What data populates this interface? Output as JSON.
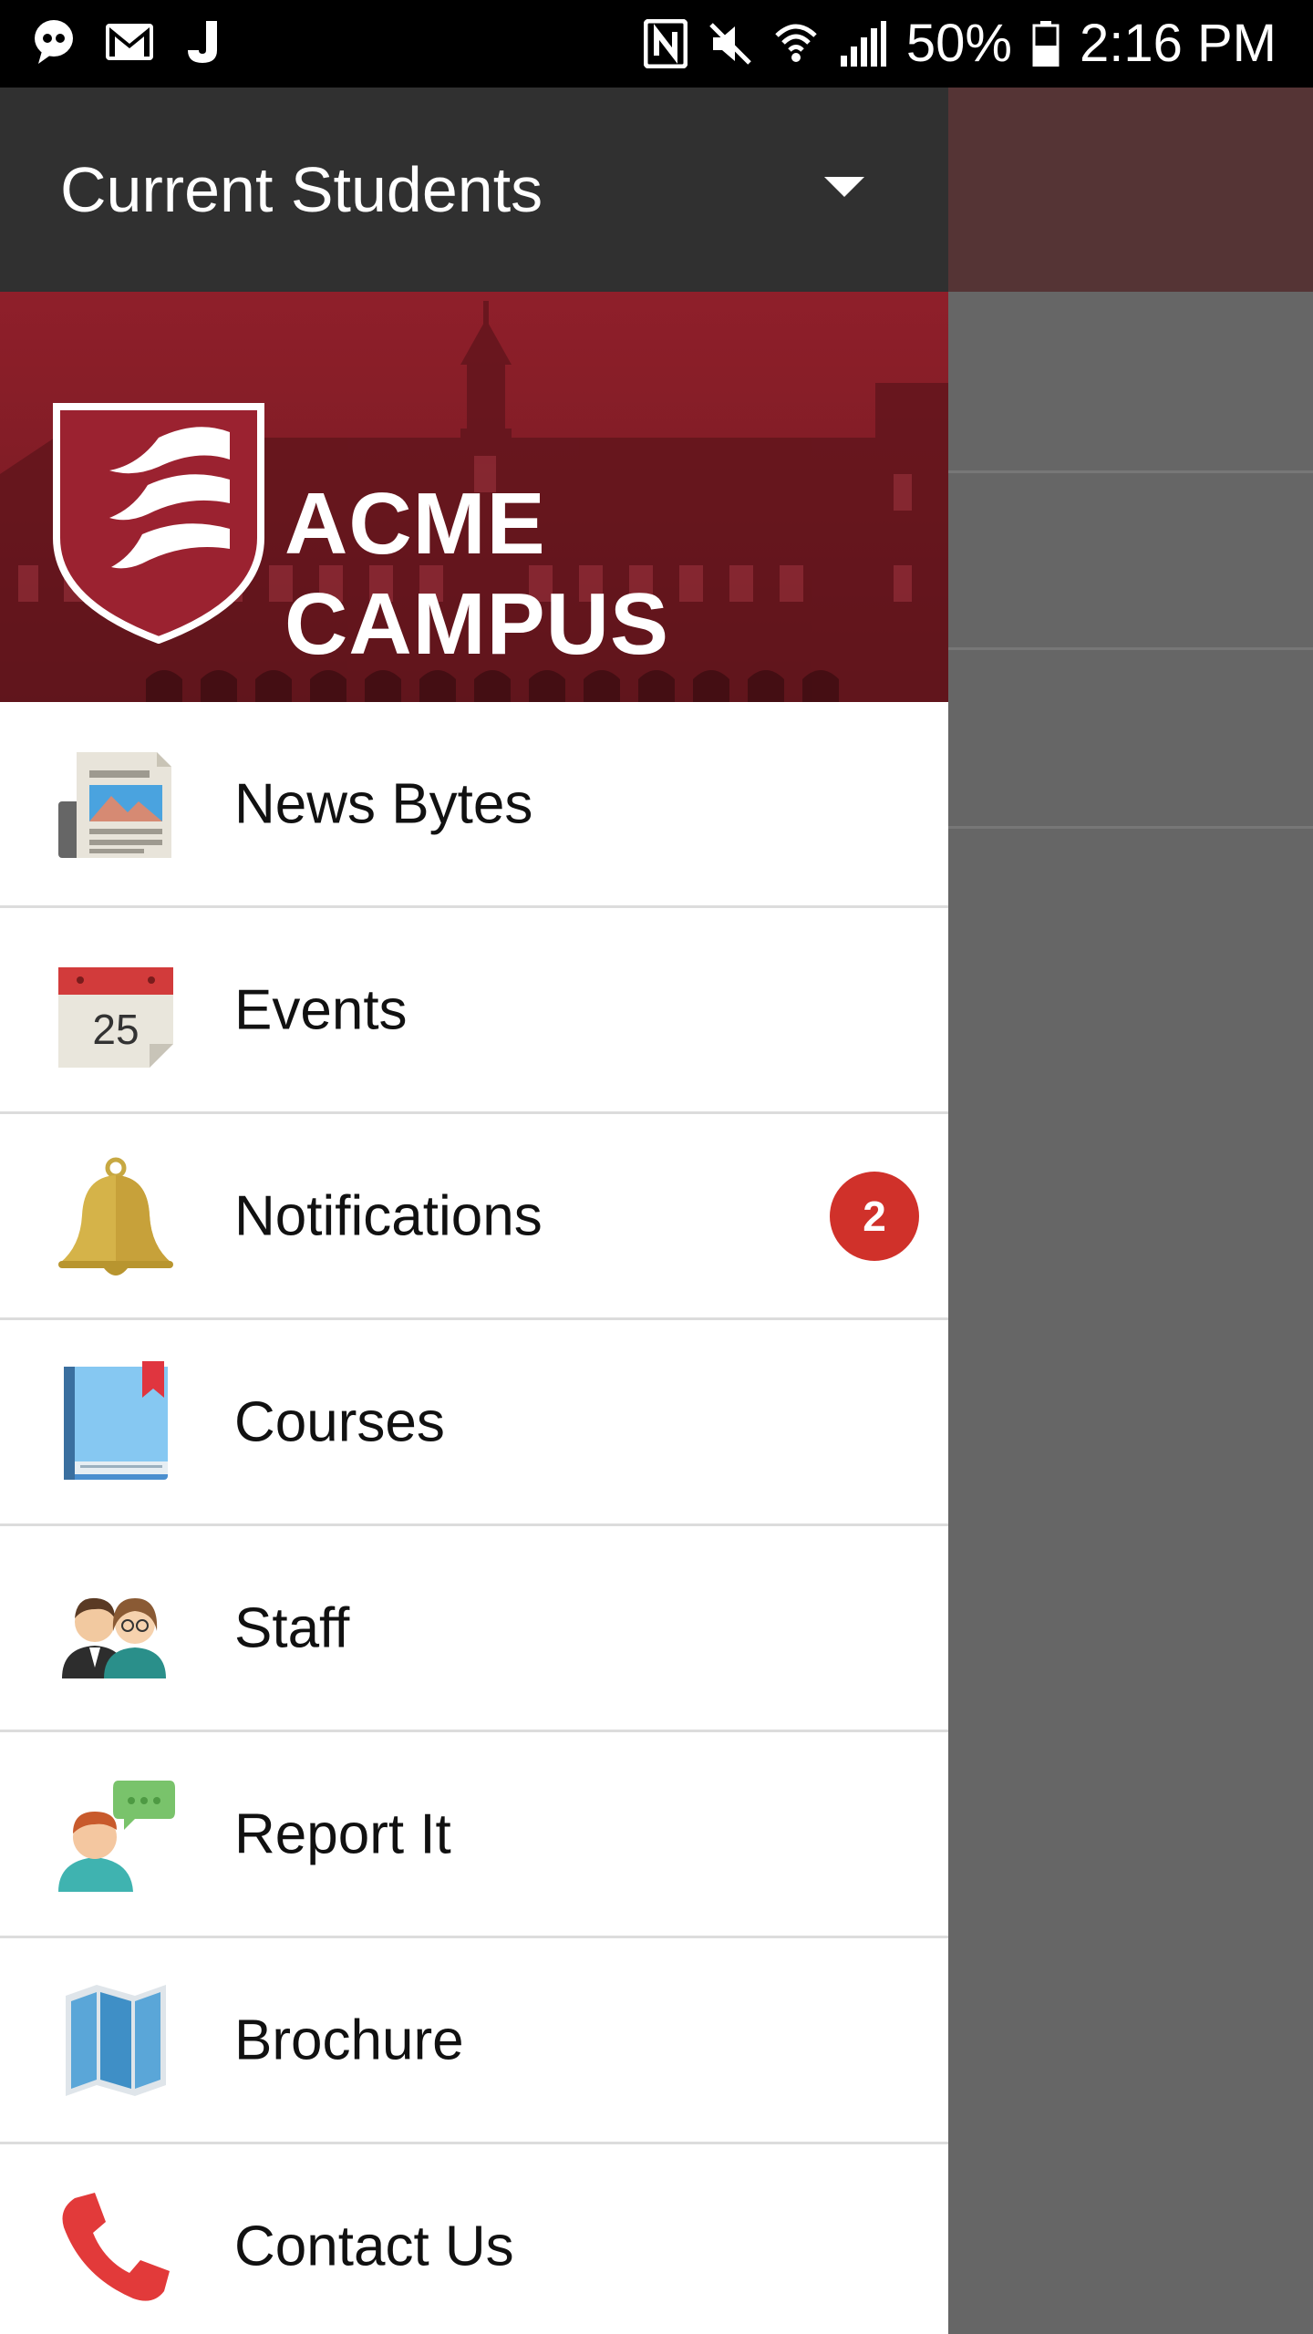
{
  "status_bar": {
    "left_icons": [
      "messenger-icon",
      "gmail-icon",
      "j-app-icon"
    ],
    "right_icons": [
      "nfc-icon",
      "mute-icon",
      "wifi-icon",
      "signal-icon",
      "battery-icon"
    ],
    "battery": "50%",
    "time": "2:16 PM"
  },
  "drawer": {
    "title": "Current Students",
    "brand_name": "ACME CAMPUS",
    "items": [
      {
        "label": "News Bytes",
        "icon": "newspaper-icon"
      },
      {
        "label": "Events",
        "icon": "calendar-icon",
        "calendar_day": "25"
      },
      {
        "label": "Notifications",
        "icon": "bell-icon",
        "badge": "2"
      },
      {
        "label": "Courses",
        "icon": "book-icon"
      },
      {
        "label": "Staff",
        "icon": "staff-icon"
      },
      {
        "label": "Report It",
        "icon": "report-icon"
      },
      {
        "label": "Brochure",
        "icon": "map-icon"
      },
      {
        "label": "Contact Us",
        "icon": "phone-icon"
      }
    ]
  },
  "colors": {
    "drawer_header": "#303030",
    "banner": "#8f1f2a",
    "badge": "#d0312a",
    "scrim": "#6b6b6b"
  }
}
